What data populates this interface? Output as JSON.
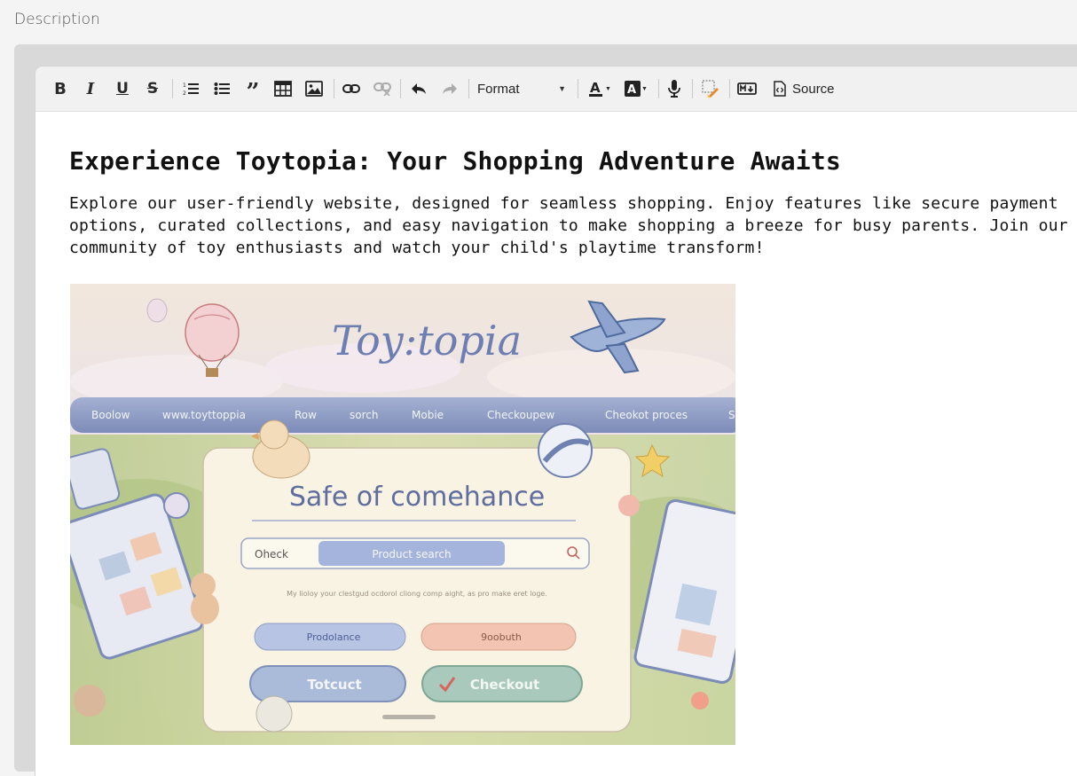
{
  "field": {
    "label": "Description"
  },
  "toolbar": {
    "buttons": [
      {
        "name": "bold",
        "icon": "bold-icon"
      },
      {
        "name": "italic",
        "icon": "italic-icon"
      },
      {
        "name": "underline",
        "icon": "underline-icon"
      },
      {
        "name": "strikethrough",
        "icon": "strikethrough-icon"
      },
      {
        "name": "ordered-list",
        "icon": "ordered-list-icon"
      },
      {
        "name": "unordered-list",
        "icon": "bullet-list-icon"
      },
      {
        "name": "blockquote",
        "icon": "quote-icon"
      },
      {
        "name": "table",
        "icon": "table-icon"
      },
      {
        "name": "image",
        "icon": "image-icon"
      },
      {
        "name": "link",
        "icon": "link-icon"
      },
      {
        "name": "unlink",
        "icon": "unlink-icon"
      },
      {
        "name": "undo",
        "icon": "undo-icon"
      },
      {
        "name": "redo",
        "icon": "redo-icon"
      },
      {
        "name": "text-color",
        "icon": "font-color-icon"
      },
      {
        "name": "background-color",
        "icon": "highlight-icon"
      },
      {
        "name": "voice",
        "icon": "microphone-icon"
      },
      {
        "name": "clear-format",
        "icon": "eraser-icon"
      },
      {
        "name": "markdown",
        "icon": "markdown-icon"
      }
    ],
    "format_label": "Format",
    "source_label": "Source"
  },
  "content": {
    "heading": "Experience Toytopia: Your Shopping Adventure Awaits",
    "paragraph": "Explore our user-friendly website, designed for seamless shopping. Enjoy features like secure payment options, curated collections, and easy navigation to make shopping a breeze for busy parents. Join our community of toy enthusiasts and watch your child's playtime transform!"
  },
  "illustration": {
    "logo": "Toy:topia",
    "nav": [
      "Boolow",
      "www.toyttoppia",
      "Row",
      "sorch",
      "Mobie",
      "Checkoupew",
      "Cheokot proces",
      "S"
    ],
    "card_title": "Safe of comehance",
    "search_left": "Oheck",
    "search_placeholder": "Product search",
    "tagline": "My lioloy your clestgud ocdorol cliong comp aight, as pro make eret loge.",
    "buttons": [
      "Prodolance",
      "9oobuth",
      "Totcuct",
      "Checkout"
    ],
    "colors": {
      "nav": "#8e9dc4",
      "card": "#f7f1df",
      "sky": "#efe3d4",
      "grass": "#c6d49a"
    }
  }
}
